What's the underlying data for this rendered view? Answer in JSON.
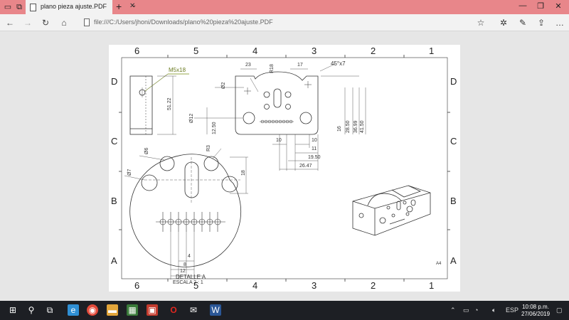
{
  "browser": {
    "tab_title": "plano pieza ajuste.PDF",
    "url": "file:///C:/Users/jhoni/Downloads/plano%20pieza%20ajuste.PDF"
  },
  "drawing": {
    "zone_columns": [
      "6",
      "5",
      "4",
      "3",
      "2",
      "1"
    ],
    "zone_rows": [
      "D",
      "C",
      "B",
      "A"
    ],
    "sheet_size": "A4",
    "detail_title": "DETALLE A",
    "detail_scale": "ESCALA 2 : 1",
    "thread_note": "M5x18",
    "chamfer_note": "45°x7",
    "dims": {
      "d23": "23",
      "r18": "R18",
      "d17": "17",
      "phi2": "Ø2",
      "d51_22": "51.22",
      "phi12": "Ø12",
      "d12_50": "12.50",
      "d16": "16",
      "d28_50": "28.50",
      "d36_99": "36.99",
      "d41_50": "41.50",
      "d10a": "10",
      "d10b": "10",
      "d11": "11",
      "d19_50": "19.50",
      "d26_47": "26.47",
      "phi6": "Ø6",
      "r3": "R3",
      "phi7": "Ø7",
      "d18": "18",
      "d4": "4",
      "d8": "8",
      "d12": "12"
    }
  },
  "taskbar": {
    "language": "ESP",
    "time": "10:08 p.m.",
    "date": "27/06/2019"
  },
  "colors": {
    "titlebar": "#e8868a",
    "taskbar": "#1d1f24",
    "viewer_bg": "#e6e6e6"
  }
}
